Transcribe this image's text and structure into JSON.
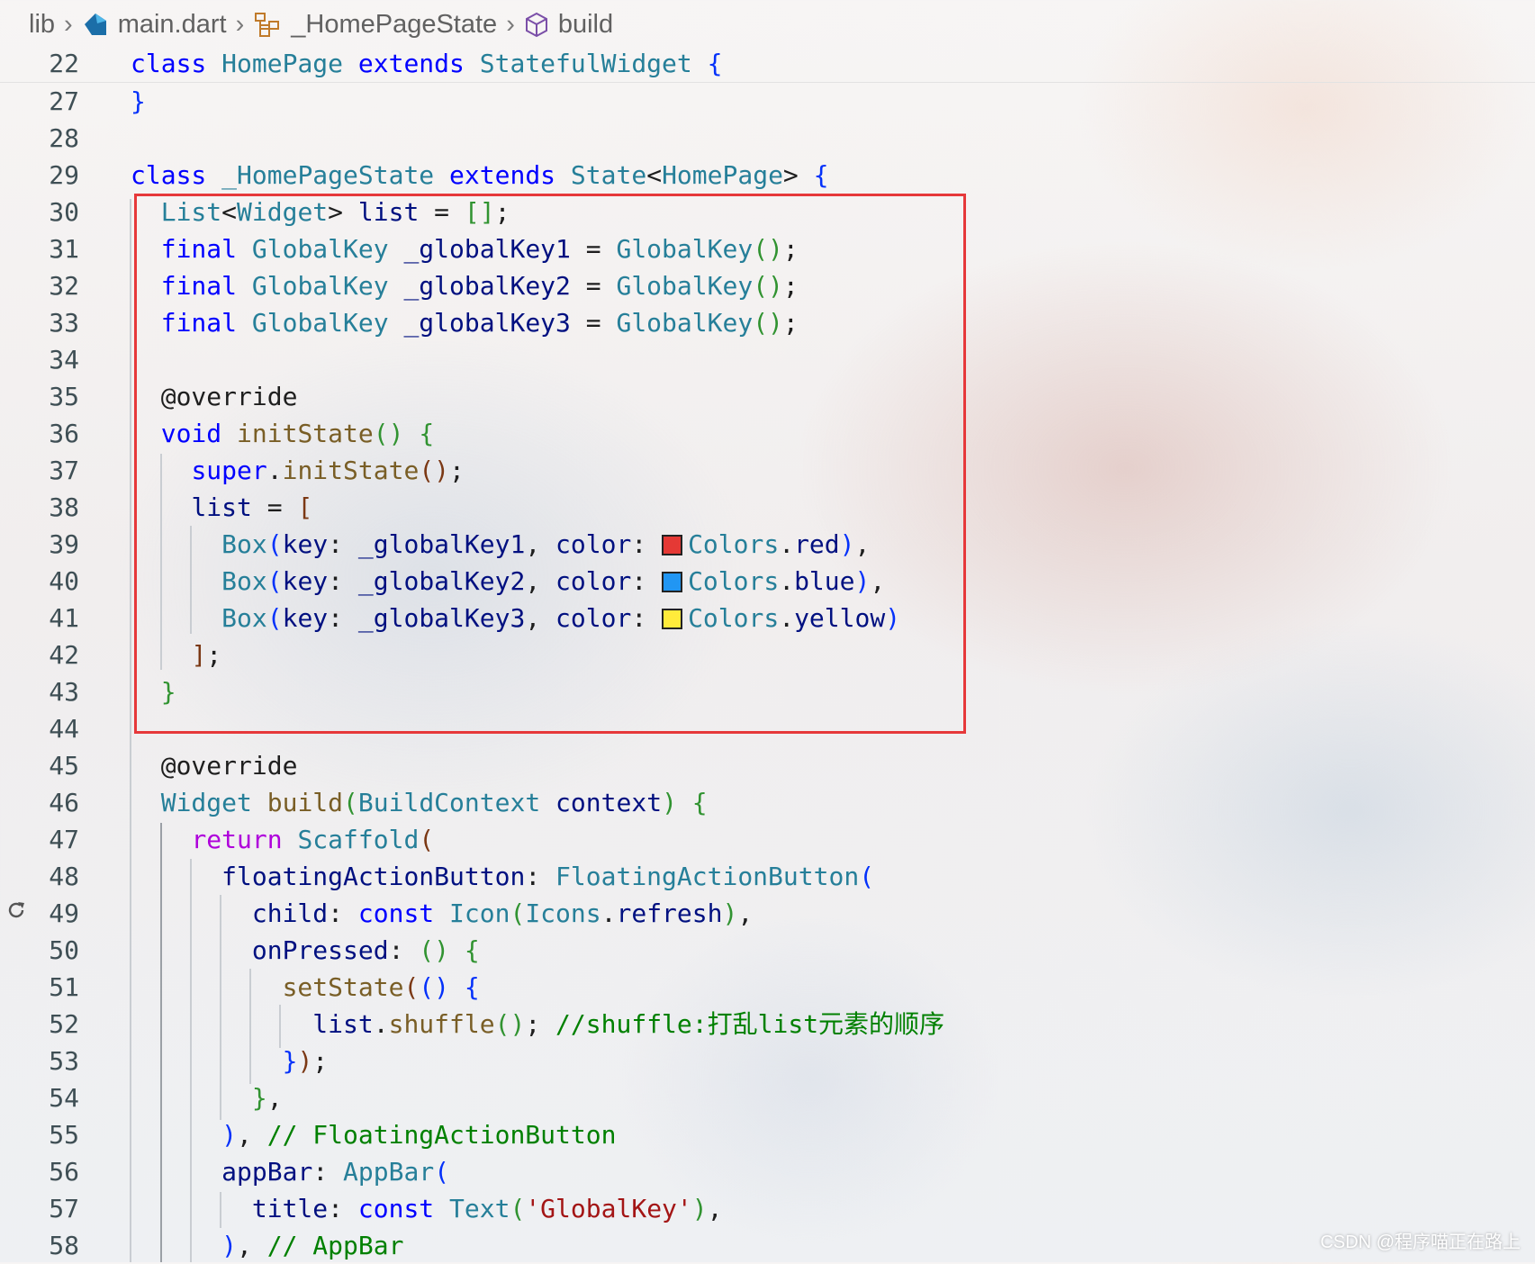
{
  "breadcrumb": {
    "items": [
      {
        "label": "lib",
        "icon": "folder"
      },
      {
        "label": "main.dart",
        "icon": "dart-file-icon"
      },
      {
        "label": "_HomePageState",
        "icon": "class-icon"
      },
      {
        "label": "build",
        "icon": "method-cube-icon"
      }
    ]
  },
  "editor": {
    "lines": [
      {
        "num": "22",
        "tokens": [
          [
            "k",
            "class"
          ],
          [
            "",
            " "
          ],
          [
            "t",
            "HomePage"
          ],
          [
            "",
            " "
          ],
          [
            "k",
            "extends"
          ],
          [
            "",
            " "
          ],
          [
            "t",
            "StatefulWidget"
          ],
          [
            "",
            " "
          ],
          [
            "b1",
            "{"
          ]
        ]
      },
      {
        "num": "27",
        "tokens": [
          [
            "b1",
            "}"
          ]
        ]
      },
      {
        "num": "28",
        "tokens": []
      },
      {
        "num": "29",
        "tokens": [
          [
            "k",
            "class"
          ],
          [
            "",
            " "
          ],
          [
            "t",
            "_HomePageState"
          ],
          [
            "",
            " "
          ],
          [
            "k",
            "extends"
          ],
          [
            "",
            " "
          ],
          [
            "t",
            "State"
          ],
          [
            "",
            "<"
          ],
          [
            "t",
            "HomePage"
          ],
          [
            "",
            "> "
          ],
          [
            "b1",
            "{"
          ]
        ]
      },
      {
        "num": "30",
        "tokens": [
          [
            "",
            "  "
          ],
          [
            "t",
            "List"
          ],
          [
            "",
            "<"
          ],
          [
            "t",
            "Widget"
          ],
          [
            "",
            "> "
          ],
          [
            "v",
            "list"
          ],
          [
            "",
            " = "
          ],
          [
            "b2",
            "[]"
          ],
          [
            "",
            ";"
          ]
        ]
      },
      {
        "num": "31",
        "tokens": [
          [
            "",
            "  "
          ],
          [
            "k",
            "final"
          ],
          [
            "",
            " "
          ],
          [
            "t",
            "GlobalKey"
          ],
          [
            "",
            " "
          ],
          [
            "v",
            "_globalKey1"
          ],
          [
            "",
            " = "
          ],
          [
            "t",
            "GlobalKey"
          ],
          [
            "b2",
            "()"
          ],
          [
            "",
            ";"
          ]
        ]
      },
      {
        "num": "32",
        "tokens": [
          [
            "",
            "  "
          ],
          [
            "k",
            "final"
          ],
          [
            "",
            " "
          ],
          [
            "t",
            "GlobalKey"
          ],
          [
            "",
            " "
          ],
          [
            "v",
            "_globalKey2"
          ],
          [
            "",
            " = "
          ],
          [
            "t",
            "GlobalKey"
          ],
          [
            "b2",
            "()"
          ],
          [
            "",
            ";"
          ]
        ]
      },
      {
        "num": "33",
        "tokens": [
          [
            "",
            "  "
          ],
          [
            "k",
            "final"
          ],
          [
            "",
            " "
          ],
          [
            "t",
            "GlobalKey"
          ],
          [
            "",
            " "
          ],
          [
            "v",
            "_globalKey3"
          ],
          [
            "",
            " = "
          ],
          [
            "t",
            "GlobalKey"
          ],
          [
            "b2",
            "()"
          ],
          [
            "",
            ";"
          ]
        ]
      },
      {
        "num": "34",
        "tokens": []
      },
      {
        "num": "35",
        "tokens": [
          [
            "",
            "  @override"
          ]
        ]
      },
      {
        "num": "36",
        "tokens": [
          [
            "",
            "  "
          ],
          [
            "k",
            "void"
          ],
          [
            "",
            " "
          ],
          [
            "f",
            "initState"
          ],
          [
            "b2",
            "()"
          ],
          [
            "",
            " "
          ],
          [
            "b2",
            "{"
          ]
        ]
      },
      {
        "num": "37",
        "tokens": [
          [
            "",
            "    "
          ],
          [
            "k",
            "super"
          ],
          [
            "",
            "."
          ],
          [
            "f",
            "initState"
          ],
          [
            "b3",
            "()"
          ],
          [
            "",
            ";"
          ]
        ]
      },
      {
        "num": "38",
        "tokens": [
          [
            "",
            "    "
          ],
          [
            "v",
            "list"
          ],
          [
            "",
            " = "
          ],
          [
            "b3",
            "["
          ]
        ]
      },
      {
        "num": "39",
        "tokens": [
          [
            "",
            "      "
          ],
          [
            "t",
            "Box"
          ],
          [
            "b1",
            "("
          ],
          [
            "v",
            "key"
          ],
          [
            "",
            ": "
          ],
          [
            "v",
            "_globalKey1"
          ],
          [
            "",
            ", "
          ],
          [
            "v",
            "color"
          ],
          [
            "",
            ": "
          ],
          [
            "sw",
            "#e53935"
          ],
          [
            "t",
            "Colors"
          ],
          [
            "",
            "."
          ],
          [
            "v",
            "red"
          ],
          [
            "b1",
            ")"
          ],
          [
            "",
            ","
          ]
        ]
      },
      {
        "num": "40",
        "tokens": [
          [
            "",
            "      "
          ],
          [
            "t",
            "Box"
          ],
          [
            "b1",
            "("
          ],
          [
            "v",
            "key"
          ],
          [
            "",
            ": "
          ],
          [
            "v",
            "_globalKey2"
          ],
          [
            "",
            ", "
          ],
          [
            "v",
            "color"
          ],
          [
            "",
            ": "
          ],
          [
            "sw",
            "#2196f3"
          ],
          [
            "t",
            "Colors"
          ],
          [
            "",
            "."
          ],
          [
            "v",
            "blue"
          ],
          [
            "b1",
            ")"
          ],
          [
            "",
            ","
          ]
        ]
      },
      {
        "num": "41",
        "tokens": [
          [
            "",
            "      "
          ],
          [
            "t",
            "Box"
          ],
          [
            "b1",
            "("
          ],
          [
            "v",
            "key"
          ],
          [
            "",
            ": "
          ],
          [
            "v",
            "_globalKey3"
          ],
          [
            "",
            ", "
          ],
          [
            "v",
            "color"
          ],
          [
            "",
            ": "
          ],
          [
            "sw",
            "#ffeb3b"
          ],
          [
            "t",
            "Colors"
          ],
          [
            "",
            "."
          ],
          [
            "v",
            "yellow"
          ],
          [
            "b1",
            ")"
          ]
        ]
      },
      {
        "num": "42",
        "tokens": [
          [
            "",
            "    "
          ],
          [
            "b3",
            "]"
          ],
          [
            "",
            ";"
          ]
        ]
      },
      {
        "num": "43",
        "tokens": [
          [
            "",
            "  "
          ],
          [
            "b2",
            "}"
          ]
        ]
      },
      {
        "num": "44",
        "tokens": []
      },
      {
        "num": "45",
        "tokens": [
          [
            "",
            "  @override"
          ]
        ]
      },
      {
        "num": "46",
        "tokens": [
          [
            "",
            "  "
          ],
          [
            "t",
            "Widget"
          ],
          [
            "",
            " "
          ],
          [
            "f",
            "build"
          ],
          [
            "b2",
            "("
          ],
          [
            "t",
            "BuildContext"
          ],
          [
            "",
            " "
          ],
          [
            "v",
            "context"
          ],
          [
            "b2",
            ")"
          ],
          [
            "",
            " "
          ],
          [
            "b2",
            "{"
          ]
        ]
      },
      {
        "num": "47",
        "tokens": [
          [
            "",
            "    "
          ],
          [
            "kc",
            "return"
          ],
          [
            "",
            " "
          ],
          [
            "t",
            "Scaffold"
          ],
          [
            "b3",
            "("
          ]
        ]
      },
      {
        "num": "48",
        "tokens": [
          [
            "",
            "      "
          ],
          [
            "v",
            "floatingActionButton"
          ],
          [
            "",
            ": "
          ],
          [
            "t",
            "FloatingActionButton"
          ],
          [
            "b1",
            "("
          ]
        ]
      },
      {
        "num": "49",
        "tokens": [
          [
            "",
            "        "
          ],
          [
            "v",
            "child"
          ],
          [
            "",
            ": "
          ],
          [
            "k",
            "const"
          ],
          [
            "",
            " "
          ],
          [
            "t",
            "Icon"
          ],
          [
            "b2",
            "("
          ],
          [
            "t",
            "Icons"
          ],
          [
            "",
            "."
          ],
          [
            "v",
            "refresh"
          ],
          [
            "b2",
            ")"
          ],
          [
            "",
            ","
          ]
        ]
      },
      {
        "num": "50",
        "tokens": [
          [
            "",
            "        "
          ],
          [
            "v",
            "onPressed"
          ],
          [
            "",
            ": "
          ],
          [
            "b2",
            "()"
          ],
          [
            "",
            " "
          ],
          [
            "b2",
            "{"
          ]
        ]
      },
      {
        "num": "51",
        "tokens": [
          [
            "",
            "          "
          ],
          [
            "f",
            "setState"
          ],
          [
            "b3",
            "("
          ],
          [
            "b1",
            "()"
          ],
          [
            "",
            " "
          ],
          [
            "b1",
            "{"
          ]
        ]
      },
      {
        "num": "52",
        "tokens": [
          [
            "",
            "            "
          ],
          [
            "v",
            "list"
          ],
          [
            "",
            "."
          ],
          [
            "f",
            "shuffle"
          ],
          [
            "b2",
            "()"
          ],
          [
            "",
            "; "
          ],
          [
            "c",
            "//shuffle:打乱list元素的顺序"
          ]
        ]
      },
      {
        "num": "53",
        "tokens": [
          [
            "",
            "          "
          ],
          [
            "b1",
            "}"
          ],
          [
            "b3",
            ")"
          ],
          [
            "",
            ";"
          ]
        ]
      },
      {
        "num": "54",
        "tokens": [
          [
            "",
            "        "
          ],
          [
            "b2",
            "}"
          ],
          [
            "",
            ","
          ]
        ]
      },
      {
        "num": "55",
        "tokens": [
          [
            "",
            "      "
          ],
          [
            "b1",
            ")"
          ],
          [
            "",
            ", "
          ],
          [
            "c",
            "// FloatingActionButton"
          ]
        ]
      },
      {
        "num": "56",
        "tokens": [
          [
            "",
            "      "
          ],
          [
            "v",
            "appBar"
          ],
          [
            "",
            ": "
          ],
          [
            "t",
            "AppBar"
          ],
          [
            "b1",
            "("
          ]
        ]
      },
      {
        "num": "57",
        "tokens": [
          [
            "",
            "        "
          ],
          [
            "v",
            "title"
          ],
          [
            "",
            ": "
          ],
          [
            "k",
            "const"
          ],
          [
            "",
            " "
          ],
          [
            "t",
            "Text"
          ],
          [
            "b2",
            "("
          ],
          [
            "s",
            "'GlobalKey'"
          ],
          [
            "b2",
            ")"
          ],
          [
            "",
            ","
          ]
        ]
      },
      {
        "num": "58",
        "tokens": [
          [
            "",
            "      "
          ],
          [
            "b1",
            ")"
          ],
          [
            "",
            ", "
          ],
          [
            "c",
            "// AppBar"
          ]
        ]
      }
    ]
  },
  "watermark": "CSDN @程序喵正在路上"
}
